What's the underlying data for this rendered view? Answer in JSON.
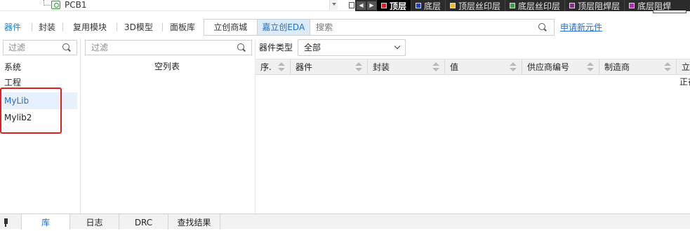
{
  "tree": {
    "node_label": "PCB1"
  },
  "layers": {
    "nav_prev": "◀",
    "nav_next": "▶",
    "items": [
      {
        "label": "顶层",
        "color": "#e02020",
        "active": true
      },
      {
        "label": "底层",
        "color": "#1a3fe0"
      },
      {
        "label": "顶层丝印层",
        "color": "#f0c020"
      },
      {
        "label": "底层丝印层",
        "color": "#40a040"
      },
      {
        "label": "顶层阻焊层",
        "color": "#8a2a8a"
      },
      {
        "label": "底层阻焊",
        "color": "#c020c0"
      }
    ]
  },
  "tabs": {
    "items": [
      "器件",
      "封装",
      "复用模块",
      "3D模型",
      "面板库"
    ],
    "active": "器件",
    "source_options": [
      "立创商城",
      "嘉立创EDA"
    ],
    "source_active": "嘉立创EDA",
    "search_placeholder": "搜索",
    "apply_link": "申请新元件"
  },
  "left_panel": {
    "filter_placeholder": "过滤",
    "items": [
      "系统",
      "工程",
      "MyLib",
      "Mylib2"
    ],
    "selected": "MyLib"
  },
  "middle": {
    "filter_placeholder": "过滤",
    "empty_text": "空列表"
  },
  "right": {
    "type_label": "器件类型",
    "type_value": "全部",
    "columns": [
      "序.",
      "器件",
      "封装",
      "值",
      "供应商编号",
      "制造商",
      "立"
    ],
    "row_fragment": "正在"
  },
  "bottom_tabs": {
    "items": [
      "库",
      "日志",
      "DRC",
      "查找结果"
    ],
    "active": "库"
  }
}
